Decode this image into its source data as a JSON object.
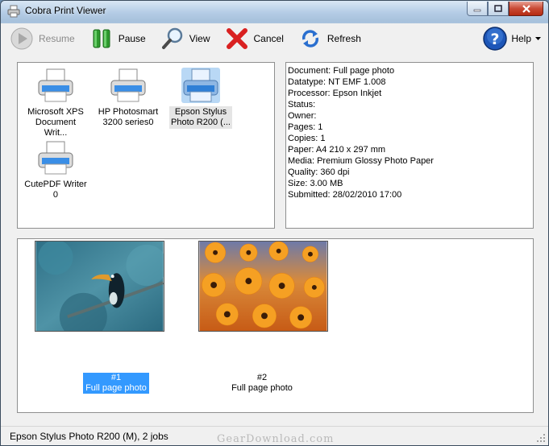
{
  "window": {
    "title": "Cobra Print Viewer"
  },
  "toolbar": {
    "resume_label": "Resume",
    "pause_label": "Pause",
    "view_label": "View",
    "cancel_label": "Cancel",
    "refresh_label": "Refresh",
    "help_label": "Help"
  },
  "printers": [
    {
      "name": "Microsoft XPS Document Writ...",
      "line1": "Microsoft XPS",
      "line2": "Document Writ...",
      "selected": false
    },
    {
      "name": "HP Photosmart 3200 series0",
      "line1": "HP Photosmart",
      "line2": "3200 series0",
      "selected": false
    },
    {
      "name": "Epson Stylus Photo R200 (...",
      "line1": "Epson Stylus",
      "line2": "Photo R200 (...",
      "selected": true
    },
    {
      "name": "CutePDF Writer 0",
      "line1": "CutePDF Writer",
      "line2": "0",
      "selected": false
    }
  ],
  "details": {
    "lines": [
      "Document: Full page photo",
      "Datatype: NT EMF 1.008",
      "Processor: Epson Inkjet",
      "Status:",
      "Owner:",
      "Pages: 1",
      "Copies: 1",
      "Paper: A4 210 x 297 mm",
      "Media: Premium Glossy Photo Paper",
      "Quality: 360 dpi",
      "Size: 3.00 MB",
      "Submitted: 28/02/2010 17:00"
    ]
  },
  "jobs": [
    {
      "number": "#1",
      "title": "Full page photo",
      "selected": true
    },
    {
      "number": "#2",
      "title": "Full page photo",
      "selected": false
    }
  ],
  "status": {
    "text": "Epson Stylus Photo R200 (M),  2 jobs",
    "watermark": "GearDownload.com"
  },
  "icons": {
    "app": "printer-icon",
    "resume": "play-icon",
    "pause": "pause-icon",
    "view": "magnifier-icon",
    "cancel": "red-x-icon",
    "refresh": "refresh-arrows-icon",
    "help": "help-icon"
  },
  "colors": {
    "selection": "#3399ff",
    "pause_green": "#2e9a2e",
    "cancel_red": "#d92020",
    "help_blue": "#1d56b8"
  }
}
